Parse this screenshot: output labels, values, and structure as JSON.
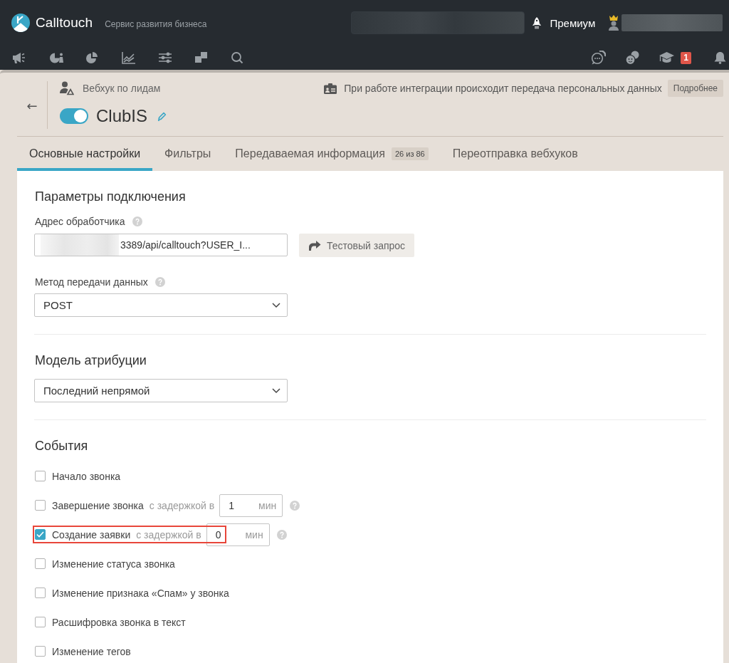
{
  "header": {
    "logo": "Calltouch",
    "tagline": "Сервис развития бизнеса",
    "plan": "Премиум"
  },
  "toolbar": {
    "badge": "1"
  },
  "page": {
    "back": "←",
    "section": "Вебхук по лидам",
    "title": "ClubIS",
    "enabled": true,
    "notice": "При работе интеграции происходит передача персональных данных",
    "notice_button": "Подробнее"
  },
  "tabs": [
    {
      "label": "Основные настройки",
      "selected": true
    },
    {
      "label": "Фильтры",
      "selected": false
    },
    {
      "label": "Передаваемая информация",
      "badge": "26 из 86",
      "selected": false
    },
    {
      "label": "Переотправка вебхуков",
      "selected": false
    }
  ],
  "connection": {
    "heading": "Параметры подключения",
    "url_label": "Адрес обработчика",
    "url_value": "3389/api/calltouch?USER_I...",
    "test_button": "Тестовый запрос",
    "method_label": "Метод передачи данных",
    "method_value": "POST"
  },
  "attribution": {
    "heading": "Модель атрибуции",
    "value": "Последний непрямой"
  },
  "events": {
    "heading": "События",
    "items": [
      {
        "kind": "plain",
        "label": "Начало звонка",
        "checked": false,
        "highlighted": false
      },
      {
        "kind": "delay",
        "label": "Завершение звонка",
        "checked": false,
        "highlighted": false,
        "delay_text": "с задержкой в",
        "value": "1",
        "unit": "мин"
      },
      {
        "kind": "delay",
        "label": "Создание заявки",
        "checked": true,
        "highlighted": true,
        "delay_text": "с задержкой в",
        "value": "0",
        "unit": "мин"
      },
      {
        "kind": "plain",
        "label": "Изменение статуса звонка",
        "checked": false,
        "highlighted": false
      },
      {
        "kind": "plain",
        "label": "Изменение признака «Спам» у звонка",
        "checked": false,
        "highlighted": false
      },
      {
        "kind": "plain",
        "label": "Расшифровка звонка в текст",
        "checked": false,
        "highlighted": false
      },
      {
        "kind": "plain",
        "label": "Изменение тегов",
        "checked": false,
        "highlighted": false
      }
    ]
  }
}
